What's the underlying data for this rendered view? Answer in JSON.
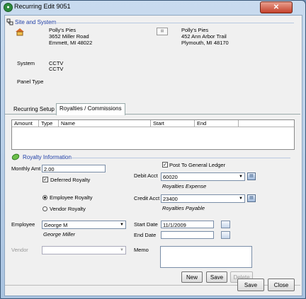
{
  "window": {
    "title": "Recurring Edit 9051",
    "close_glyph": "✕"
  },
  "site": {
    "header": "Site and System",
    "site_name": "Polly's Pies",
    "site_addr1": "3652 Miller Road",
    "site_addr2": "Emmett, MI  48022",
    "bill_name": "Polly's Pies",
    "bill_addr1": "452 Ann Arbor Trail",
    "bill_addr2": "Plymouth, MI  48170",
    "system_label": "System",
    "system_line1": "CCTV",
    "system_line2": "CCTV",
    "panel_type_label": "Panel Type"
  },
  "tabs": [
    {
      "label": "Recurring Setup"
    },
    {
      "label": "Royalties / Commissions"
    }
  ],
  "grid": {
    "columns": [
      "Amount",
      "Type",
      "Name",
      "Start",
      "End"
    ]
  },
  "royalty": {
    "header": "Royalty Information",
    "monthly_amt_label": "Monthly Amt",
    "monthly_amt_value": "2.00",
    "deferred_label": "Deferred Royalty",
    "deferred_checked": true,
    "post_gl_label": "Post To General Ledger",
    "post_gl_checked": true,
    "debit_label": "Debit Acct",
    "debit_value": "60020",
    "debit_desc": "Royalties Expense",
    "employee_royalty_label": "Employee Royalty",
    "vendor_royalty_label": "Vendor Royalty",
    "selected_royalty": "employee",
    "credit_label": "Credit Acct",
    "credit_value": "23400",
    "credit_desc": "Royalties Payable",
    "employee_label": "Employee",
    "employee_value": "George M",
    "employee_full": "George Miller",
    "start_label": "Start Date",
    "start_value": "11/1/2009",
    "end_label": "End Date",
    "end_value": "",
    "vendor_label": "Vendor",
    "vendor_value": "",
    "memo_label": "Memo",
    "memo_value": ""
  },
  "buttons": {
    "new": "New",
    "save_inner": "Save",
    "delete": "Delete",
    "save": "Save",
    "close": "Close"
  },
  "colors": {
    "accent": "#1f3fa8",
    "title_bar": "#a9c3e0",
    "close": "#c4412b"
  }
}
